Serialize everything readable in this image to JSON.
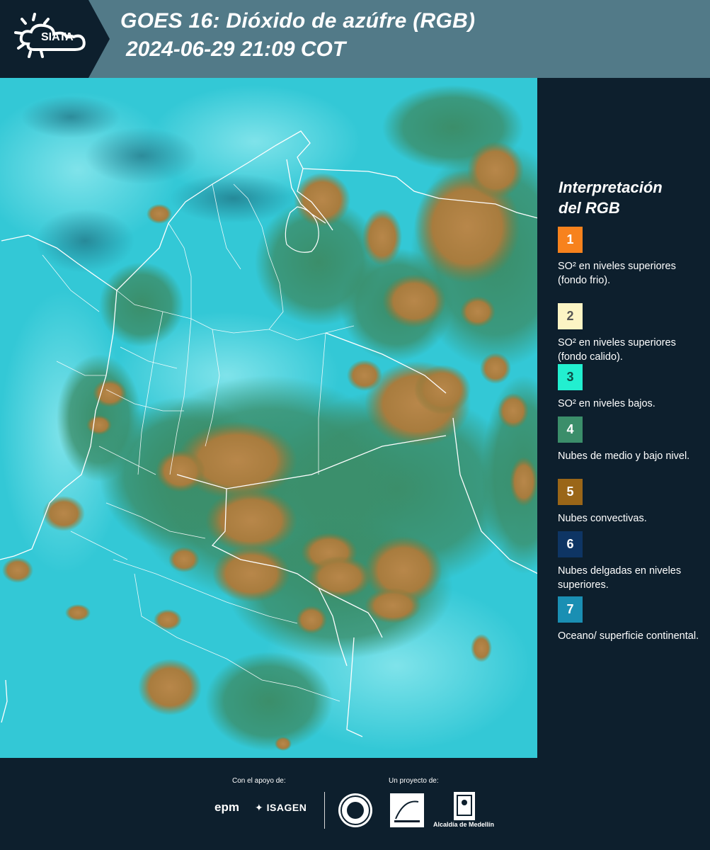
{
  "header": {
    "logo_text": "SIATA",
    "title": "GOES 16: Dióxido de azúfre (RGB)",
    "datetime": "2024-06-29 21:09 COT"
  },
  "legend": {
    "title_line1": "Interpretación",
    "title_line2": "del RGB",
    "items": [
      {
        "number": "1",
        "color": "#f7821d",
        "text_color": "#ffffff",
        "text": "SO² en niveles superiores (fondo frio)."
      },
      {
        "number": "2",
        "color": "#fcf4c4",
        "text_color": "#555555",
        "text": "SO² en niveles superiores (fondo calido)."
      },
      {
        "number": "3",
        "color": "#22efd0",
        "text_color": "#0d4d45",
        "text": "SO² en niveles bajos."
      },
      {
        "number": "4",
        "color": "#3b8e6a",
        "text_color": "#ffffff",
        "text": "Nubes de medio y bajo nivel."
      },
      {
        "number": "5",
        "color": "#9a6618",
        "text_color": "#ffffff",
        "text": "Nubes convectivas."
      },
      {
        "number": "6",
        "color": "#0e3564",
        "text_color": "#ffffff",
        "text": "Nubes delgadas en niveles superiores."
      },
      {
        "number": "7",
        "color": "#1a8fb3",
        "text_color": "#ffffff",
        "text": "Oceano/ superficie continental."
      }
    ]
  },
  "footer": {
    "support_label": "Con el apoyo de:",
    "project_label": "Un proyecto de:",
    "epm": "epm",
    "isagen": "ISAGEN",
    "alcaldia": "Alcaldía de Medellín"
  },
  "colors": {
    "map_background": "#33c8d6",
    "cloud_convective": "#a87c3e",
    "cloud_mid_low": "#3b8e6a",
    "border_lines": "#ffffff"
  }
}
